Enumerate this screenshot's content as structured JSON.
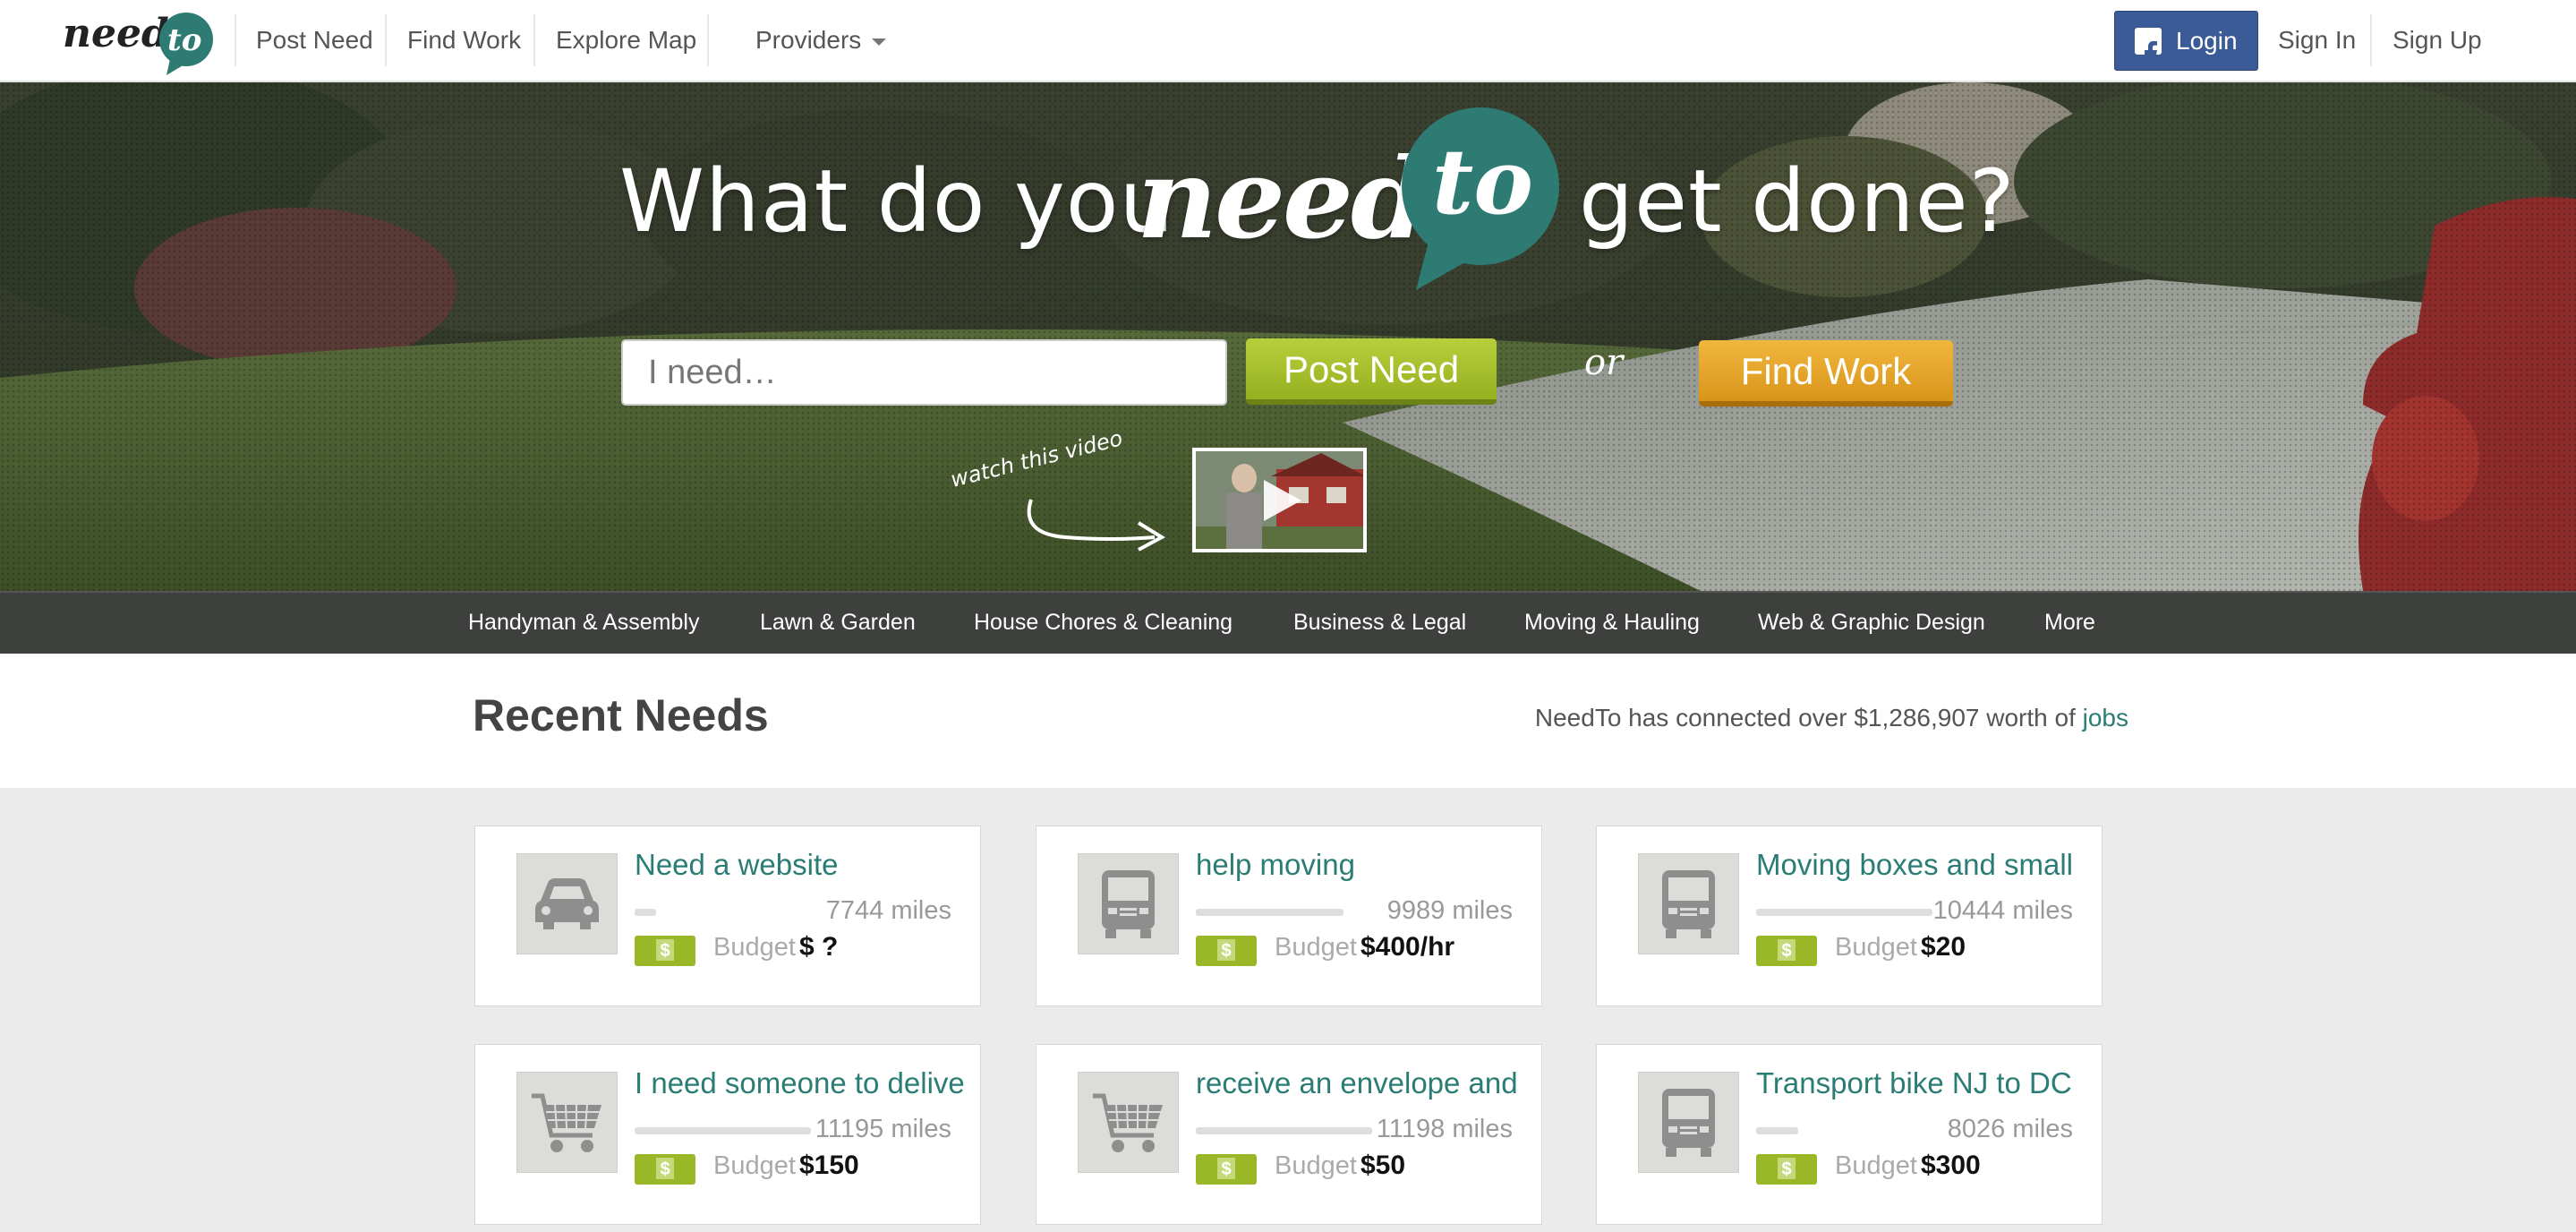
{
  "nav": {
    "logo_word_need": "need",
    "logo_word_to": "to",
    "post_need": "Post Need",
    "find_work": "Find Work",
    "explore_map": "Explore Map",
    "providers": "Providers",
    "login": "Login",
    "sign_in": "Sign In",
    "sign_up": "Sign Up"
  },
  "hero": {
    "headline_left": "What do you",
    "headline_need": "need",
    "headline_to": "to",
    "headline_right": "get done?",
    "input_placeholder": "I need…",
    "post_need_button": "Post Need",
    "or": "or",
    "find_work_button": "Find Work",
    "watch_video": "watch this video"
  },
  "categories": [
    "Handyman & Assembly",
    "Lawn & Garden",
    "House Chores & Cleaning",
    "Business & Legal",
    "Moving & Hauling",
    "Web & Graphic Design",
    "More"
  ],
  "recent": {
    "title": "Recent Needs",
    "connected_text": "NeedTo has connected over $1,286,907 worth of",
    "connected_link": "jobs"
  },
  "listings": [
    {
      "title": "Need a website",
      "miles": "7744 miles",
      "budget_label": "Budget",
      "budget": "$ ?",
      "icon": "car-icon",
      "progress": 0.05
    },
    {
      "title": "help moving",
      "miles": "9989 miles",
      "budget_label": "Budget",
      "budget": "$400/hr",
      "icon": "truck-icon",
      "progress": 0.35
    },
    {
      "title": "Moving boxes and small",
      "miles": "10444 miles",
      "budget_label": "Budget",
      "budget": "$20",
      "icon": "truck-icon",
      "progress": 0.42
    },
    {
      "title": "I need someone to deliver",
      "miles": "11195 miles",
      "budget_label": "Budget",
      "budget": "$150",
      "icon": "shopping-cart-icon",
      "progress": 0.42
    },
    {
      "title": "receive an envelope and",
      "miles": "11198 miles",
      "budget_label": "Budget",
      "budget": "$50",
      "icon": "shopping-cart-icon",
      "progress": 0.42
    },
    {
      "title": "Transport bike NJ to DC",
      "miles": "8026 miles",
      "budget_label": "Budget",
      "budget": "$300",
      "icon": "truck-icon",
      "progress": 0.1
    }
  ],
  "colors": {
    "brand_teal": "#2a7d74",
    "post_green": "#9ab727",
    "find_orange": "#e0a020",
    "facebook_blue": "#3b5b97"
  }
}
